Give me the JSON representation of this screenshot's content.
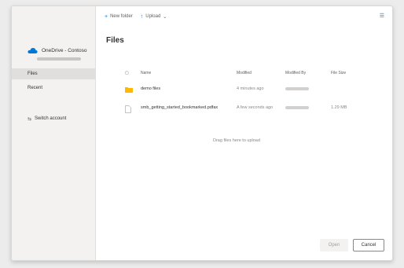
{
  "sidebar": {
    "account_name": "OneDrive - Contoso",
    "items": [
      {
        "label": "Files"
      },
      {
        "label": "Recent"
      },
      {
        "label": "Switch account"
      }
    ]
  },
  "toolbar": {
    "new_folder": "New folder",
    "upload": "Upload"
  },
  "main": {
    "title": "Files",
    "columns": [
      "Name",
      "Modified",
      "Modified By",
      "File Size"
    ],
    "rows": [
      {
        "name": "demo files",
        "modified": "4 minutes ago",
        "modified_by": "",
        "size": ""
      },
      {
        "name": "smb_getting_started_bookmarked.pdfax",
        "modified": "A few seconds ago",
        "modified_by": "",
        "size": "1.29 MB"
      }
    ],
    "drop_hint": "Drag files here to upload"
  },
  "footer": {
    "open": "Open",
    "cancel": "Cancel"
  },
  "colors": {
    "accent": "#0078d4",
    "folder": "#ffb900"
  }
}
